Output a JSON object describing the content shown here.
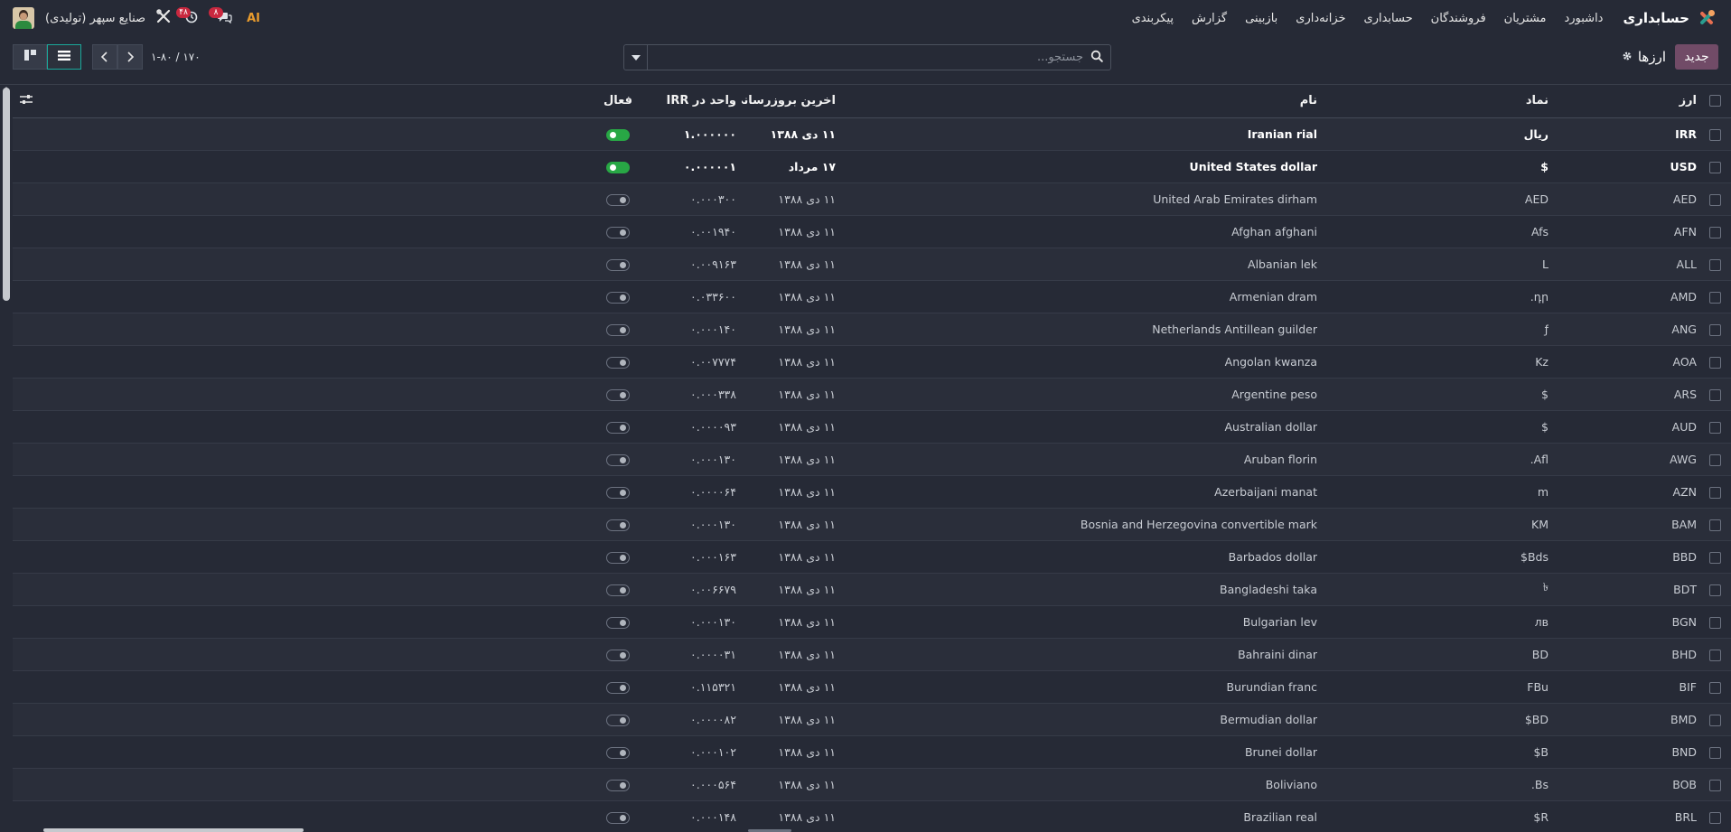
{
  "app": {
    "name": "حسابداری",
    "menu": [
      "داشبورد",
      "مشتریان",
      "فروشندگان",
      "حسابداری",
      "خزانه‌داری",
      "بازبینی",
      "گزارش",
      "پیکربندی"
    ]
  },
  "systray": {
    "company": "صنایع سپهر (تولیدی)",
    "activity_count": "۴۸",
    "messages_count": "۸",
    "ai_label": "AI"
  },
  "control": {
    "new_label": "جدید",
    "breadcrumb_title": "ارزها",
    "search_placeholder": "جستجو...",
    "pager": "۱-۸۰ / ۱۷۰"
  },
  "table": {
    "headers": {
      "code": "ارز",
      "symbol": "نماد",
      "name": "نام",
      "last_update": "اخرین بروزرسانی",
      "rate": "واحد در IRR",
      "active": "فعال"
    },
    "rows": [
      {
        "code": "IRR",
        "symbol": "ریال",
        "name": "Iranian rial",
        "date": "۱۱ دی ۱۳۸۸",
        "rate": "۱.۰۰۰۰۰۰",
        "active": true
      },
      {
        "code": "USD",
        "symbol": "$",
        "name": "United States dollar",
        "date": "۱۷ مرداد",
        "rate": "۰.۰۰۰۰۰۱",
        "active": true
      },
      {
        "code": "AED",
        "symbol": "AED",
        "name": "United Arab Emirates dirham",
        "date": "۱۱ دی ۱۳۸۸",
        "rate": "۰.۰۰۰۳۰۰",
        "active": false
      },
      {
        "code": "AFN",
        "symbol": "Afs",
        "name": "Afghan afghani",
        "date": "۱۱ دی ۱۳۸۸",
        "rate": "۰.۰۰۱۹۴۰",
        "active": false
      },
      {
        "code": "ALL",
        "symbol": "L",
        "name": "Albanian lek",
        "date": "۱۱ دی ۱۳۸۸",
        "rate": "۰.۰۰۹۱۶۳",
        "active": false
      },
      {
        "code": "AMD",
        "symbol": "դր.",
        "name": "Armenian dram",
        "date": "۱۱ دی ۱۳۸۸",
        "rate": "۰.۰۳۳۶۰۰",
        "active": false
      },
      {
        "code": "ANG",
        "symbol": "ƒ",
        "name": "Netherlands Antillean guilder",
        "date": "۱۱ دی ۱۳۸۸",
        "rate": "۰.۰۰۰۱۴۰",
        "active": false
      },
      {
        "code": "AOA",
        "symbol": "Kz",
        "name": "Angolan kwanza",
        "date": "۱۱ دی ۱۳۸۸",
        "rate": "۰.۰۰۷۷۷۴",
        "active": false
      },
      {
        "code": "ARS",
        "symbol": "$",
        "name": "Argentine peso",
        "date": "۱۱ دی ۱۳۸۸",
        "rate": "۰.۰۰۰۳۳۸",
        "active": false
      },
      {
        "code": "AUD",
        "symbol": "$",
        "name": "Australian dollar",
        "date": "۱۱ دی ۱۳۸۸",
        "rate": "۰.۰۰۰۰۹۳",
        "active": false
      },
      {
        "code": "AWG",
        "symbol": "Afl.",
        "name": "Aruban florin",
        "date": "۱۱ دی ۱۳۸۸",
        "rate": "۰.۰۰۰۱۳۰",
        "active": false
      },
      {
        "code": "AZN",
        "symbol": "m",
        "name": "Azerbaijani manat",
        "date": "۱۱ دی ۱۳۸۸",
        "rate": "۰.۰۰۰۰۶۴",
        "active": false
      },
      {
        "code": "BAM",
        "symbol": "KM",
        "name": "Bosnia and Herzegovina convertible mark",
        "date": "۱۱ دی ۱۳۸۸",
        "rate": "۰.۰۰۰۱۳۰",
        "active": false
      },
      {
        "code": "BBD",
        "symbol": "Bds$",
        "name": "Barbados dollar",
        "date": "۱۱ دی ۱۳۸۸",
        "rate": "۰.۰۰۰۱۶۳",
        "active": false
      },
      {
        "code": "BDT",
        "symbol": "৳",
        "name": "Bangladeshi taka",
        "date": "۱۱ دی ۱۳۸۸",
        "rate": "۰.۰۰۶۶۷۹",
        "active": false
      },
      {
        "code": "BGN",
        "symbol": "лв",
        "name": "Bulgarian lev",
        "date": "۱۱ دی ۱۳۸۸",
        "rate": "۰.۰۰۰۱۳۰",
        "active": false
      },
      {
        "code": "BHD",
        "symbol": "BD",
        "name": "Bahraini dinar",
        "date": "۱۱ دی ۱۳۸۸",
        "rate": "۰.۰۰۰۰۳۱",
        "active": false
      },
      {
        "code": "BIF",
        "symbol": "FBu",
        "name": "Burundian franc",
        "date": "۱۱ دی ۱۳۸۸",
        "rate": "۰.۱۱۵۳۲۱",
        "active": false
      },
      {
        "code": "BMD",
        "symbol": "BD$",
        "name": "Bermudian dollar",
        "date": "۱۱ دی ۱۳۸۸",
        "rate": "۰.۰۰۰۰۸۲",
        "active": false
      },
      {
        "code": "BND",
        "symbol": "B$",
        "name": "Brunei dollar",
        "date": "۱۱ دی ۱۳۸۸",
        "rate": "۰.۰۰۰۱۰۲",
        "active": false
      },
      {
        "code": "BOB",
        "symbol": "Bs.",
        "name": "Boliviano",
        "date": "۱۱ دی ۱۳۸۸",
        "rate": "۰.۰۰۰۵۶۴",
        "active": false
      },
      {
        "code": "BRL",
        "symbol": "R$",
        "name": "Brazilian real",
        "date": "۱۱ دی ۱۳۸۸",
        "rate": "۰.۰۰۰۱۴۸",
        "active": false
      }
    ]
  },
  "colors": {
    "background": "#262a36",
    "primary": "#714b67",
    "toggle_on": "#28a745",
    "badge": "#c9283f",
    "active_view": "#1aa89a"
  },
  "icons": {
    "app": "accounting-app-icon",
    "search": "search-icon",
    "gear": "gear-icon",
    "tools": "tools-icon",
    "clock": "clock-icon",
    "chat": "chat-icon",
    "list_view": "list-view-icon",
    "kanban_view": "kanban-view-icon",
    "optional_columns": "sliders-icon"
  }
}
